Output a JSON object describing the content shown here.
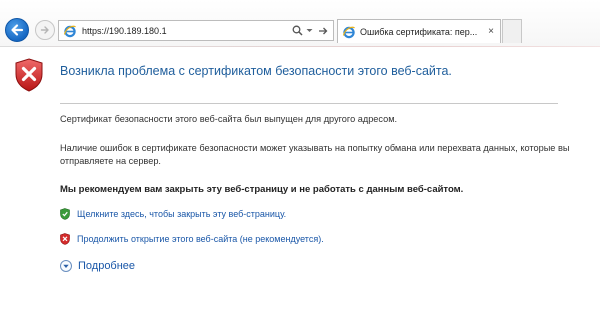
{
  "toolbar": {
    "back_icon": "back-arrow-icon",
    "forward_icon": "forward-arrow-icon",
    "address": "https://190.189.180.1",
    "search_icon": "search-icon",
    "dropdown_icon": "chevron-down-icon",
    "go_icon": "go-arrow-icon",
    "tab_title": "Ошибка сертификата: пер...",
    "tab_close": "×",
    "accent": "#1668c4"
  },
  "content": {
    "heading": "Возникла проблема с сертификатом безопасности этого веб-сайта.",
    "para1": "Сертификат безопасности этого веб-сайта был выпущен для другого адресом.",
    "para2": "Наличие ошибок в сертификате безопасности может указывать на попытку обмана или перехвата данных, которые вы отправляете на сервер.",
    "recommendation": "Мы рекомендуем вам закрыть эту веб-страницу и не работать с данным веб-сайтом.",
    "close_link": "Щелкните здесь, чтобы закрыть эту веб-страницу.",
    "continue_link": "Продолжить открытие этого веб-сайта (не рекомендуется).",
    "more_info": "Подробнее",
    "heading_color": "#1f5e9c",
    "link_color": "#1a57a8",
    "danger_color": "#d42b2b",
    "safe_color": "#3a9a3a"
  }
}
